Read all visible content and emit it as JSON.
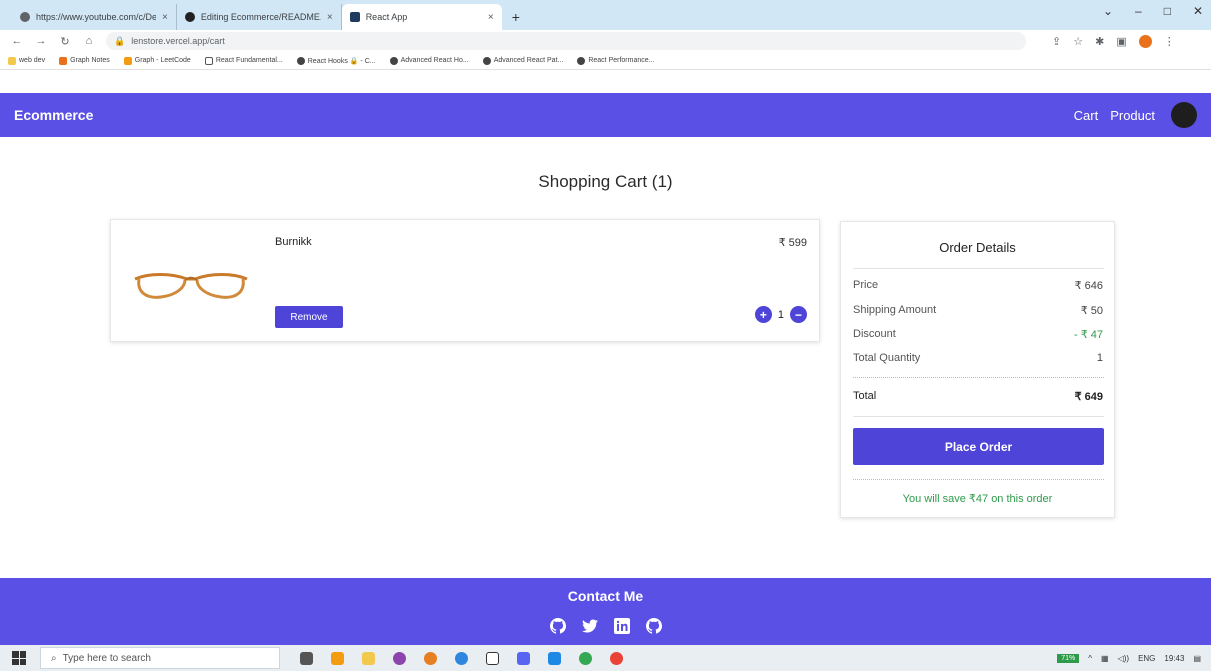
{
  "browser": {
    "tabs": [
      {
        "title": "https://www.youtube.com/c/Dev",
        "favicon_color": "#5f6368",
        "close": "×"
      },
      {
        "title": "Editing Ecommerce/README.md",
        "favicon_color": "#222222",
        "close": "×"
      },
      {
        "title": "React App",
        "favicon_color": "#1f3a5f",
        "close": "×"
      }
    ],
    "new_tab": "+",
    "url": "lenstore.vercel.app/cart",
    "window_controls": [
      "⌄",
      "–",
      "□",
      "✕"
    ],
    "bookmarks": [
      {
        "label": "web dev",
        "color": "#f2c94c"
      },
      {
        "label": "Graph Notes",
        "color": "#e8711a"
      },
      {
        "label": "Graph - LeetCode",
        "color": "#f39c12"
      },
      {
        "label": "React Fundamental...",
        "color": "#555555"
      },
      {
        "label": "React Hooks 🔒 - C...",
        "color": "#444444"
      },
      {
        "label": "Advanced React Ho...",
        "color": "#444444"
      },
      {
        "label": "Advanced React Pat...",
        "color": "#444444"
      },
      {
        "label": "React Performance...",
        "color": "#444444"
      }
    ]
  },
  "navbar": {
    "brand": "Ecommerce",
    "links": [
      "Cart",
      "Product"
    ]
  },
  "cart": {
    "heading": "Shopping Cart (1)",
    "items": [
      {
        "name": "Burnikk",
        "price": "₹ 599",
        "quantity": "1",
        "remove_label": "Remove",
        "plus": "+",
        "minus": "−"
      }
    ]
  },
  "order": {
    "title": "Order Details",
    "rows": [
      {
        "label": "Price",
        "value": "₹ 646"
      },
      {
        "label": "Shipping Amount",
        "value": "₹ 50"
      },
      {
        "label": "Discount",
        "value": "- ₹ 47"
      },
      {
        "label": "Total Quantity",
        "value": "1"
      }
    ],
    "total": {
      "label": "Total",
      "value": "₹ 649"
    },
    "place_order_label": "Place Order",
    "savings_text": "You will save ₹47 on this order"
  },
  "footer": {
    "title": "Contact Me",
    "icons": [
      "github-icon",
      "twitter-icon",
      "linkedin-icon",
      "github-icon"
    ]
  },
  "taskbar": {
    "search_placeholder": "Type here to search",
    "battery": "71%",
    "language": "ENG",
    "time": "19:43"
  },
  "colors": {
    "primary": "#5b50e6",
    "button": "#4e44d8",
    "success": "#2e9b4b"
  }
}
